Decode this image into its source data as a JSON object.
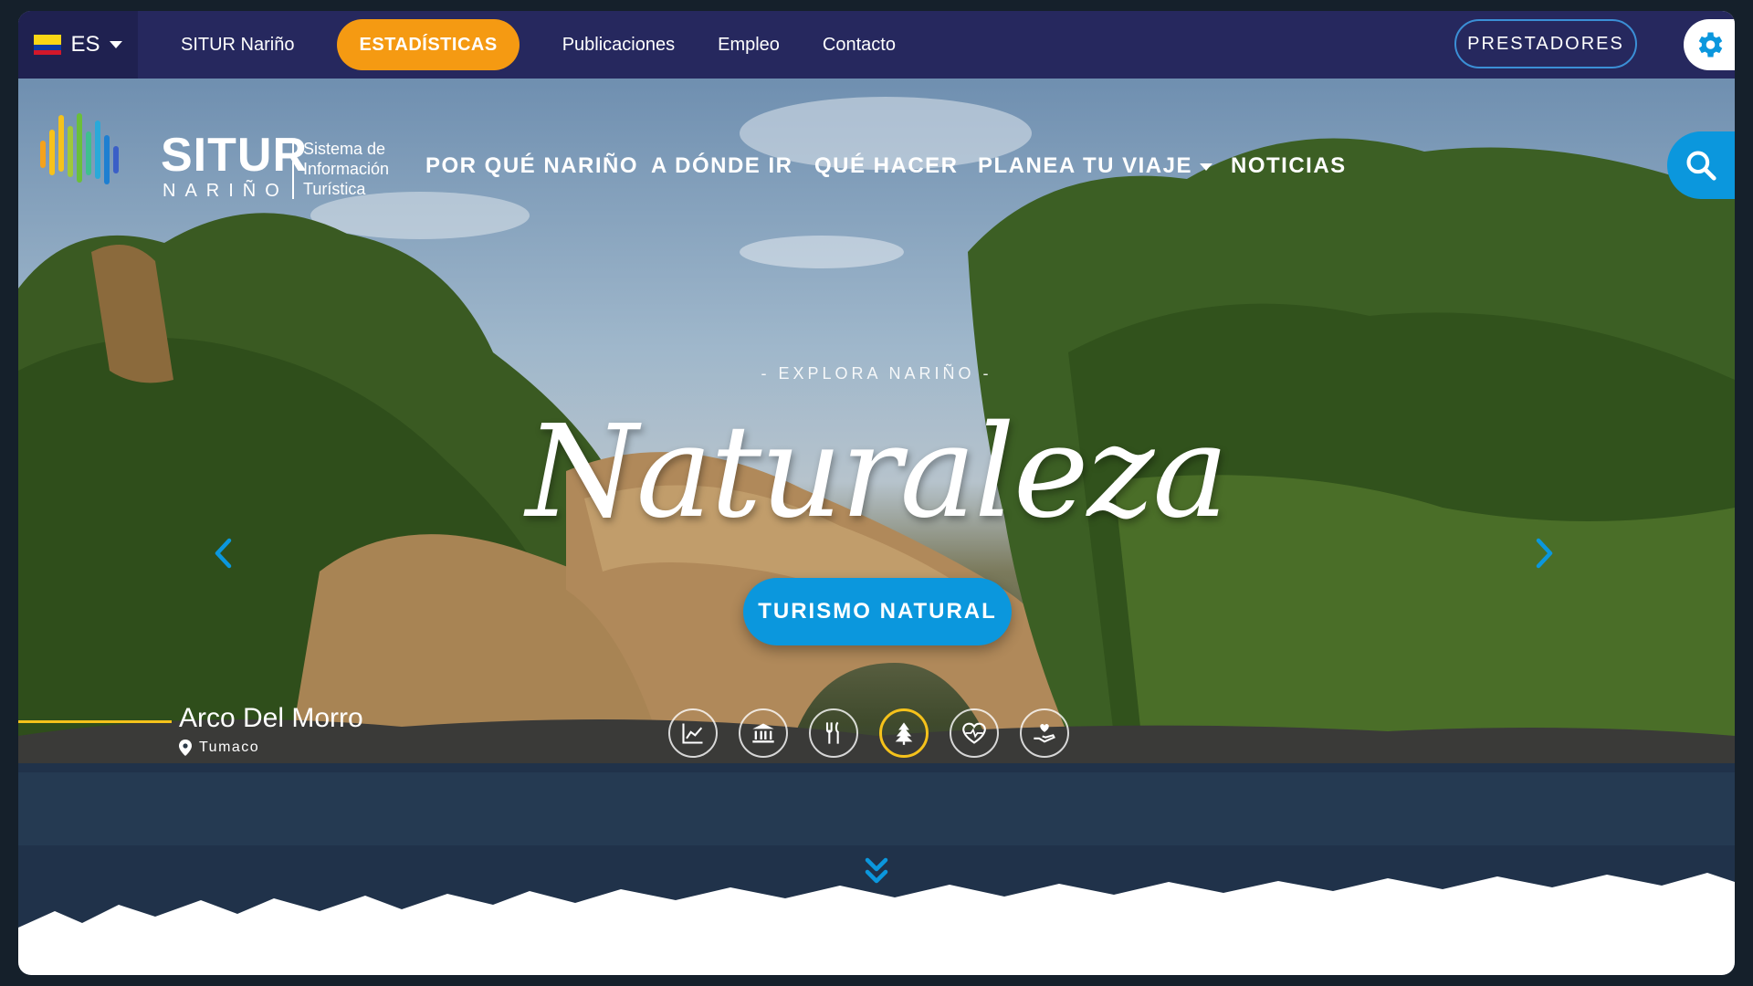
{
  "colors": {
    "topbar_bg": "#26285e",
    "stats_orange": "#f59a12",
    "accent_blue": "#0b97dd",
    "active_yellow": "#f5c21b",
    "flag": [
      "#f9d616",
      "#0b3aa3",
      "#d3172a"
    ]
  },
  "topbar": {
    "language": "ES",
    "language_flag": "colombia-flag-icon",
    "links": [
      "SITUR Nariño",
      "ESTADÍSTICAS",
      "Publicaciones",
      "Empleo",
      "Contacto"
    ],
    "situr_label": "SITUR Nariño",
    "stats_label": "ESTADÍSTICAS",
    "pub_label": "Publicaciones",
    "empleo_label": "Empleo",
    "contacto_label": "Contacto",
    "providers_label": "PRESTADORES",
    "settings_icon": "gear-icon"
  },
  "logo": {
    "name": "SITUR",
    "region": "NARIÑO",
    "desc_line1": "Sistema de",
    "desc_line2": "Información",
    "desc_line3": "Turística"
  },
  "nav": {
    "item1": "POR QUÉ NARIÑO",
    "item2": "A DÓNDE IR",
    "item3": "QUÉ HACER",
    "item4": "PLANEA TU VIAJE",
    "item5": "NOTICIAS",
    "search_icon": "search-icon"
  },
  "hero": {
    "kicker": "- EXPLORA NARIÑO -",
    "headline": "Naturaleza",
    "cta": "TURISMO NATURAL",
    "place_name": "Arco Del Morro",
    "place_location": "Tumaco",
    "categories": [
      {
        "icon": "chart-icon",
        "active": false
      },
      {
        "icon": "museum-icon",
        "active": false
      },
      {
        "icon": "fork-knife-icon",
        "active": false
      },
      {
        "icon": "tree-icon",
        "active": true
      },
      {
        "icon": "heartbeat-icon",
        "active": false
      },
      {
        "icon": "hand-heart-icon",
        "active": false
      }
    ]
  }
}
